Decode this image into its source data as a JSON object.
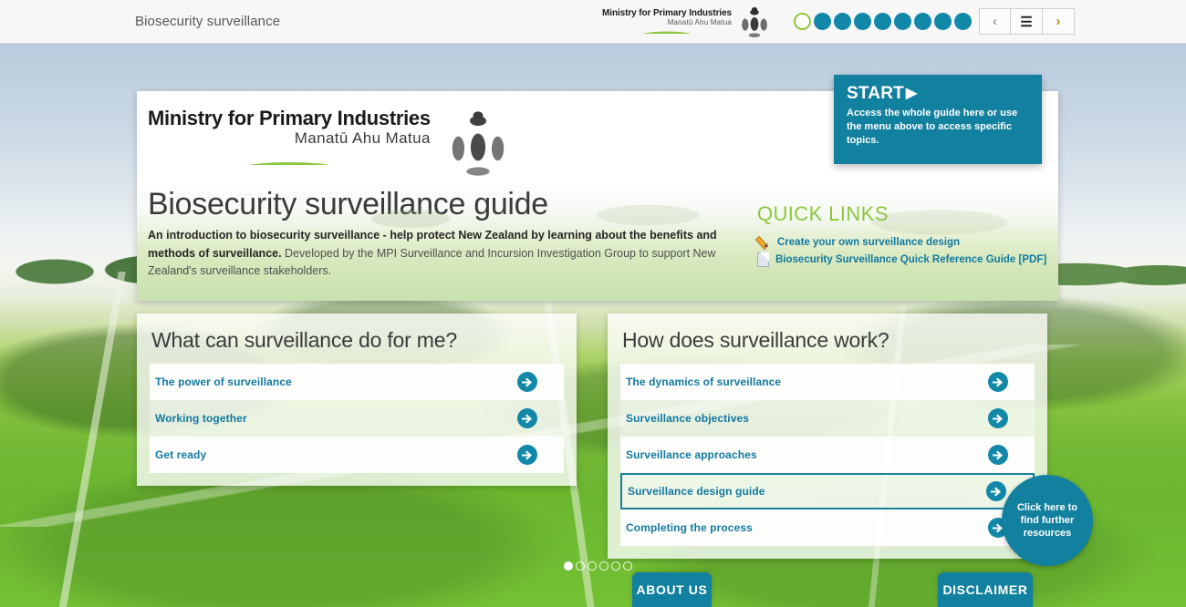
{
  "topbar": {
    "title": "Biosecurity surveillance",
    "brand": {
      "line1": "Ministry for Primary Industries",
      "line2": "Manatū Ahu Matua",
      "crest_icon": "nz-coat-of-arms-icon",
      "swoosh_icon": "green-swoosh-icon"
    },
    "progress": {
      "total": 9,
      "current_index": 0,
      "dot_filled_color": "#1288a8",
      "dot_current_border_color": "#8dc63f"
    },
    "nav": {
      "prev_icon": "chevron-left-icon",
      "menu_icon": "hamburger-menu-icon",
      "next_icon": "chevron-right-icon"
    }
  },
  "start_callout": {
    "heading": "START",
    "heading_icon": "play-triangle-icon",
    "body": "Access the whole guide here or use the menu above to access specific topics.",
    "bg_color": "#12809f"
  },
  "header_card": {
    "brand": {
      "line1": "Ministry for Primary Industries",
      "line2": "Manatū Ahu Matua",
      "crest_icon": "nz-coat-of-arms-icon",
      "swoosh_icon": "green-swoosh-icon"
    },
    "title": "Biosecurity surveillance guide",
    "description_bold": "An introduction to biosecurity surveillance - help protect New Zealand by learning about the benefits and methods of surveillance.",
    "description_rest": " Developed by the MPI Surveillance and Incursion Investigation Group to support New Zealand's surveillance stakeholders.",
    "quick_links": {
      "title": "QUICK LINKS",
      "title_color": "#8dc63f",
      "items": [
        {
          "icon": "pencil-icon",
          "label": "Create your own surveillance design"
        },
        {
          "icon": "pdf-document-icon",
          "label": "Biosecurity Surveillance Quick Reference Guide [PDF]"
        }
      ]
    }
  },
  "panels": [
    {
      "heading": "What can surveillance do for me?",
      "rows": [
        {
          "label": "The power of surveillance",
          "style": "light",
          "active": false,
          "arrow_icon": "arrow-right-circle-icon"
        },
        {
          "label": "Working together",
          "style": "dark",
          "active": false,
          "arrow_icon": "arrow-right-circle-icon"
        },
        {
          "label": "Get ready",
          "style": "light",
          "active": false,
          "arrow_icon": "arrow-right-circle-icon"
        }
      ]
    },
    {
      "heading": "How does surveillance work?",
      "rows": [
        {
          "label": "The dynamics of surveillance",
          "style": "light",
          "active": false,
          "arrow_icon": "arrow-right-circle-icon"
        },
        {
          "label": "Surveillance objectives",
          "style": "dark",
          "active": false,
          "arrow_icon": "arrow-right-circle-icon"
        },
        {
          "label": "Surveillance approaches",
          "style": "light",
          "active": false,
          "arrow_icon": "arrow-right-circle-icon"
        },
        {
          "label": "Surveillance design guide",
          "style": "dark",
          "active": true,
          "arrow_icon": "arrow-right-circle-icon"
        },
        {
          "label": "Completing the process",
          "style": "light",
          "active": false,
          "arrow_icon": "arrow-right-circle-icon"
        }
      ]
    }
  ],
  "resources_bubble": {
    "line1": "Click here to",
    "line2": "find further",
    "line3": "resources",
    "bg_color": "#12809f"
  },
  "slide_dots": {
    "total": 6,
    "current_index": 0
  },
  "bottom_buttons": {
    "about": "ABOUT US",
    "disclaimer": "DISCLAIMER",
    "color": "#12809f"
  }
}
